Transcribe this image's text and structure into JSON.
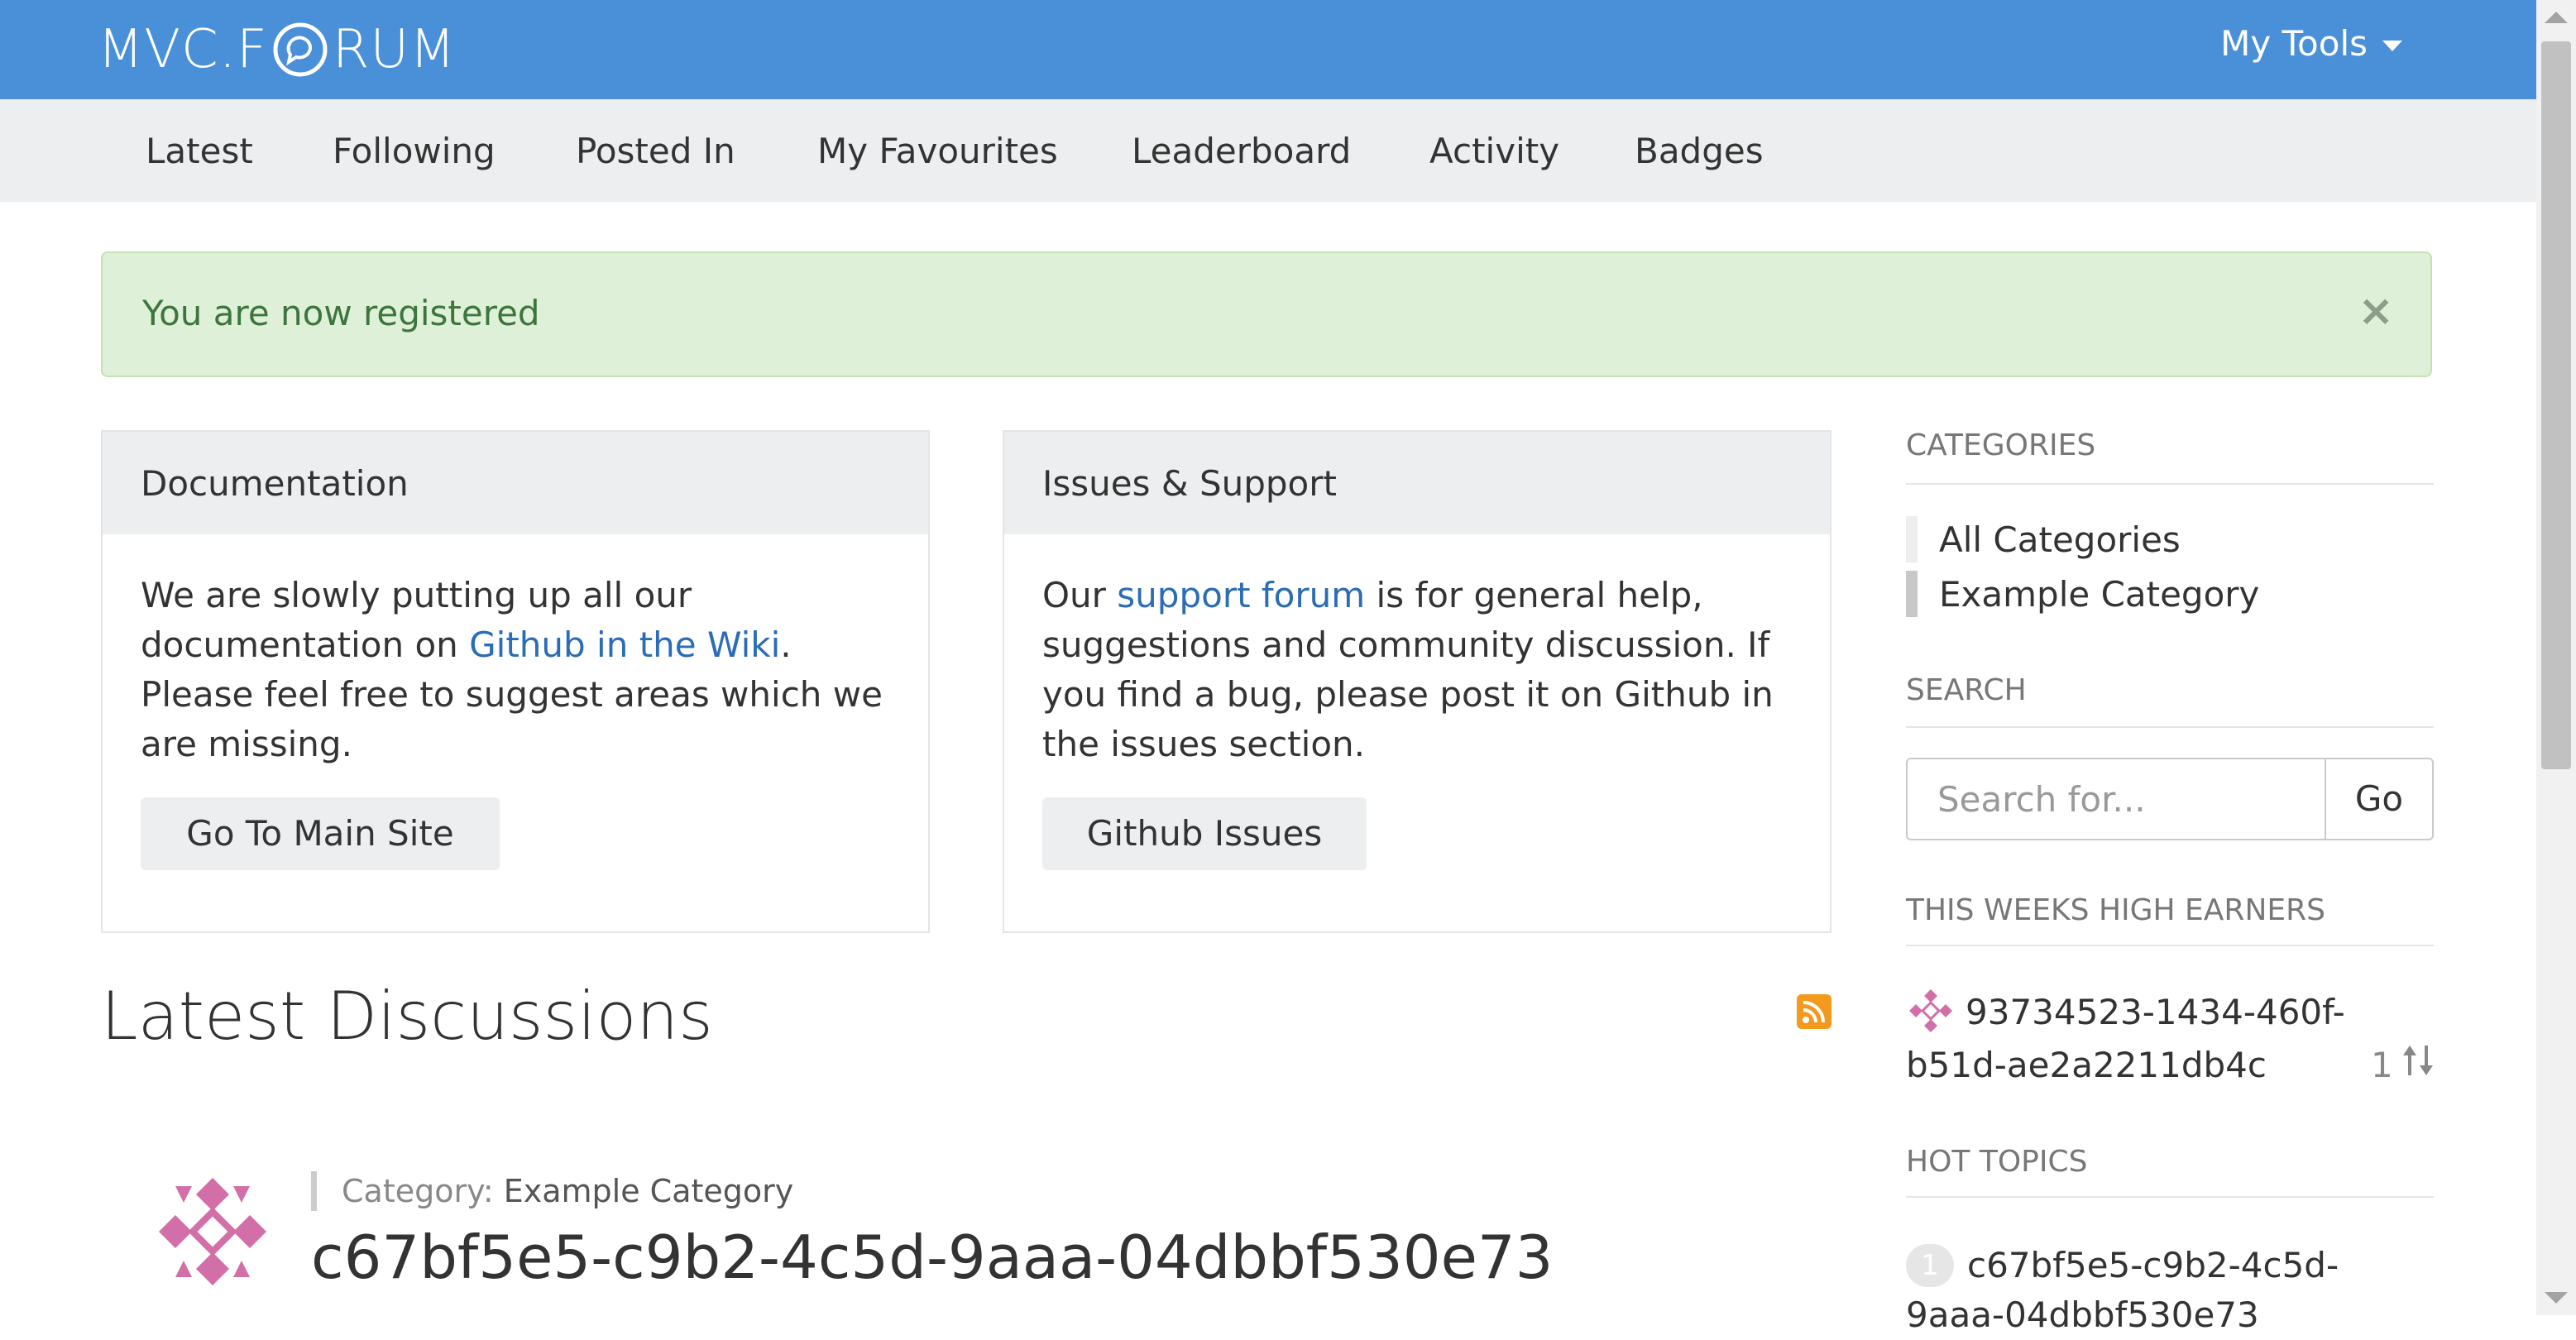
{
  "header": {
    "logo_left": "MVC.F",
    "logo_right": "RUM",
    "my_tools": "My Tools"
  },
  "nav": {
    "items": [
      "Latest",
      "Following",
      "Posted In",
      "My Favourites",
      "Leaderboard",
      "Activity",
      "Badges"
    ]
  },
  "alert": {
    "message": "You are now registered",
    "close": "×"
  },
  "panels": [
    {
      "title": "Documentation",
      "text_before": "We are slowly putting up all our documentation on ",
      "link": "Github in the Wiki",
      "text_after": ". Please feel free to suggest areas which we are missing.",
      "button": "Go To Main Site"
    },
    {
      "title": "Issues & Support",
      "text_before": "Our ",
      "link": "support forum",
      "text_after": " is for general help, suggestions and community discussion. If you find a bug, please post it on Github in the issues section.",
      "button": "Github Issues"
    }
  ],
  "latest": {
    "title": "Latest Discussions",
    "topic": {
      "category_label": "Category:",
      "category_name": "Example Category",
      "title": "c67bf5e5-c9b2-4c5d-9aaa-04dbbf530e73"
    }
  },
  "sidebar": {
    "categories_heading": "CATEGORIES",
    "categories": [
      "All Categories",
      "Example Category"
    ],
    "search_heading": "SEARCH",
    "search_placeholder": "Search for...",
    "search_button": "Go",
    "earners_heading": "THIS WEEKS HIGH EARNERS",
    "earner_name": "93734523-1434-460f-b51d-ae2a2211db4c",
    "earner_points": "1",
    "hot_heading": "HOT TOPICS",
    "hot_number": "1",
    "hot_title": "c67bf5e5-c9b2-4c5d-9aaa-04dbbf530e73"
  },
  "colors": {
    "header_bg": "#4a90d9",
    "nav_bg": "#eceeef",
    "alert_bg": "#dff0d8",
    "alert_text": "#3c763d",
    "link": "#2a6cb5",
    "rss": "#f39a1e",
    "avatar_pink": "#d36fa8"
  }
}
